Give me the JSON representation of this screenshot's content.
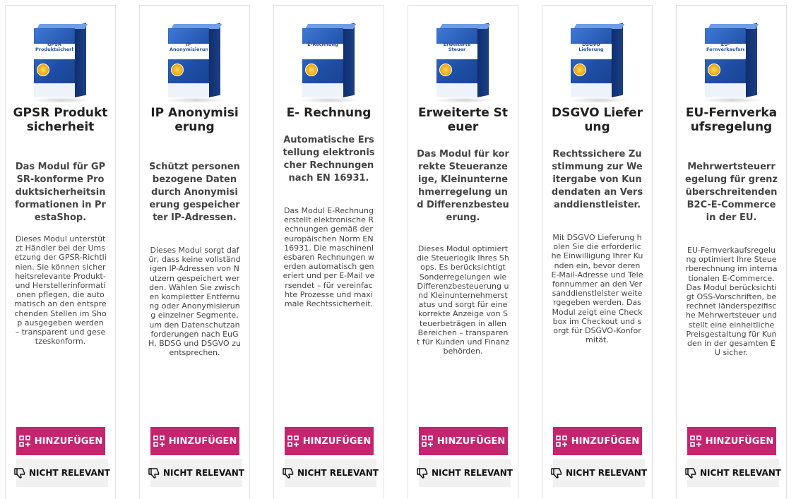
{
  "actions": {
    "add_label": "HINZUFÜGEN",
    "skip_label": "NICHT RELEVANT"
  },
  "colors": {
    "accent": "#c4256e",
    "secondary_bg": "#f1f1f1",
    "box_blue": "#1e4fa6"
  },
  "icons": {
    "add": "apps-add-icon",
    "skip": "thumbs-down-icon"
  },
  "modules": [
    {
      "box_name": "GPSR Produktsicherheit",
      "title": "GPSR Produktsicherheit",
      "subtitle": "Das Modul für GPSR-konforme Produktsicherheitsinformationen in PrestaShop.",
      "description": "Dieses Modul unterstützt Händler bei der Umsetzung der GPSR-Richtlinien. Sie können sicherheitsrelevante Produkt- und Herstellerinformationen pflegen, die automatisch an den entsprechenden Stellen im Shop ausgegeben werden – transparent und gesetzeskonform."
    },
    {
      "box_name": "IP Anonymisierung",
      "title": "IP Anonymisierung",
      "subtitle": "Schützt personenbezogene Daten durch Anonymisierung gespeicherter IP-Adressen.",
      "description": "Dieses Modul sorgt dafür, dass keine vollständigen IP-Adressen von Nutzern gespeichert werden. Wählen Sie zwischen kompletter Entfernung oder Anonymisierung einzelner Segmente, um den Datenschutzanforderungen nach EuGH, BDSG und DSGVO zu entsprechen."
    },
    {
      "box_name": "E-Rechnung",
      "title": "E- Rechnung",
      "subtitle": "Automatische Erstellung elektronischer Rechnungen nach EN 16931.",
      "description": "Das Modul E-Rechnung erstellt elektronische Rechnungen gemäß der europäischen Norm EN 16931. Die maschinenlesbaren Rechnungen werden automatisch generiert und per E-Mail versendet – für vereinfachte Prozesse und maximale Rechtssicherheit."
    },
    {
      "box_name": "Erweiterte Steuer",
      "title": "Erweiterte Steuer",
      "subtitle": "Das Modul für korrekte Steueranzeige, Kleinunternehmerregelung und Differenzbesteuerung.",
      "description": "Dieses Modul optimiert die Steuerlogik Ihres Shops. Es berücksichtigt Sonderregelungen wie Differenzbesteuerung und Kleinunternehmerstatus und sorgt für eine korrekte Anzeige von Steuerbeträgen in allen Bereichen – transparent für Kunden und Finanzbehörden."
    },
    {
      "box_name": "DSGVO Lieferung",
      "title": "DSGVO Lieferung",
      "subtitle": "Rechtssichere Zustimmung zur Weitergabe von Kundendaten an Versanddienstleister.",
      "description": "Mit DSGVO Lieferung holen Sie die erforderliche Einwilligung Ihrer Kunden ein, bevor deren E-Mail-Adresse und Telefonnummer an den Versanddienstleister weitergegeben werden. Das Modul zeigt eine Checkbox im Checkout und sorgt für DSGVO-Konformität."
    },
    {
      "box_name": "EU-Fernverkaufsregelung",
      "title": "EU-Fernverkaufsregelung",
      "subtitle": "Mehrwertsteuerregelung für grenzüberschreitenden B2C-E-Commerce in der EU.",
      "description": "EU-Fernverkaufsregelung optimiert Ihre Steuerberechnung im internationalen E-Commerce. Das Modul berücksichtigt OSS-Vorschriften, berechnet länderspezifische Mehrwertsteuer und stellt eine einheitliche Preisgestaltung für Kunden in der gesamten EU sicher."
    }
  ]
}
